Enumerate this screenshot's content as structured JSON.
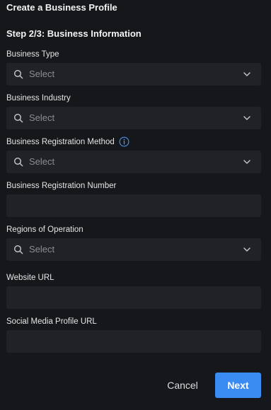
{
  "header": {
    "title": "Create a Business Profile",
    "step": "Step 2/3: Business Information"
  },
  "fields": {
    "business_type": {
      "label": "Business Type",
      "placeholder": "Select"
    },
    "business_industry": {
      "label": "Business Industry",
      "placeholder": "Select"
    },
    "registration_method": {
      "label": "Business Registration Method",
      "placeholder": "Select",
      "info_icon": "info-icon"
    },
    "registration_number": {
      "label": "Business Registration Number",
      "value": ""
    },
    "regions": {
      "label": "Regions of Operation",
      "placeholder": "Select"
    },
    "website_url": {
      "label": "Website URL",
      "value": ""
    },
    "social_url": {
      "label": "Social Media Profile URL",
      "value": ""
    }
  },
  "actions": {
    "cancel_label": "Cancel",
    "next_label": "Next"
  },
  "colors": {
    "background": "#16171a",
    "field_background": "#212226",
    "accent": "#3b8cf2",
    "placeholder": "#8a8c92"
  }
}
